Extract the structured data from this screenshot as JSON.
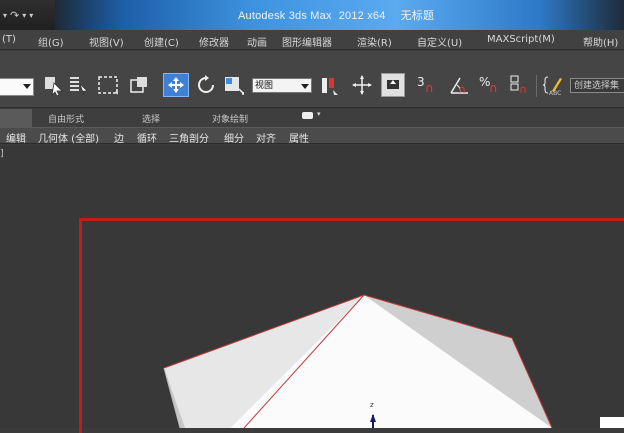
{
  "window": {
    "title_app": "Autodesk 3ds Max",
    "title_version": "2012 x64",
    "title_doc": "无标题"
  },
  "quick_access": {
    "redo_glyph": "↷",
    "more_glyph": "▾"
  },
  "menu": {
    "items": [
      "(T)",
      "组(G)",
      "视图(V)",
      "创建(C)",
      "修改器",
      "动画",
      "图形编辑器",
      "渲染(R)",
      "自定义(U)",
      "MAXScript(M)",
      "帮助(H)"
    ]
  },
  "toolbar": {
    "view_label": "视图",
    "snap_3": "3",
    "angle_snap_glyph": "∩",
    "percent_snap": "%",
    "named_selection": "创建选择集"
  },
  "ribbon": {
    "tabs": [
      "自由形式",
      "选择",
      "对象绘制"
    ],
    "panel_items": [
      "编辑",
      "几何体 (全部)",
      "边",
      "循环",
      "三角剖分",
      "细分",
      "对齐",
      "属性"
    ]
  },
  "viewport": {
    "label": "] ",
    "frame_color": "#c01c1c",
    "gizmo_axis_label": "z"
  },
  "colors": {
    "title_glow": "#3e93e0",
    "selection_highlight": "#3f7fd4",
    "object_outline": "#c23a3a"
  }
}
